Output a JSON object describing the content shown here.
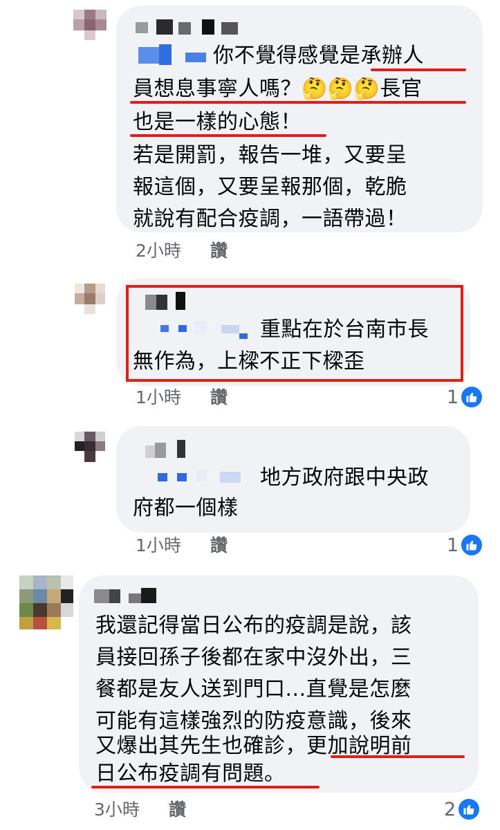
{
  "comments": [
    {
      "lines": [
        "你不覺得感覺是承辦人",
        "員想息事寧人嗎？🤔🤔🤔長官",
        "也是一樣的心態！",
        "若是開罰，報告一堆，又要呈",
        "報這個，又要呈報那個，乾脆",
        "就說有配合疫調，一語帶過！"
      ],
      "time": "2小時",
      "like_label": "讚",
      "reaction_count": ""
    },
    {
      "lines": [
        "重點在於台南市長",
        "無作為，上樑不正下樑歪"
      ],
      "time": "1小時",
      "like_label": "讚",
      "reaction_count": "1"
    },
    {
      "lines": [
        "地方政府跟中央政",
        "府都一個樣"
      ],
      "time": "1小時",
      "like_label": "讚",
      "reaction_count": "1"
    },
    {
      "lines": [
        "我還記得當日公布的疫調是說，該",
        "員接回孫子後都在家中沒外出，三",
        "餐都是友人送到門口...直覺是怎麼",
        "可能有這樣強烈的防疫意識，後來",
        "又爆出其先生也確診，更加說明前",
        "日公布疫調有問題。"
      ],
      "time": "3小時",
      "like_label": "讚",
      "reaction_count": "2"
    }
  ],
  "colors": {
    "bubble": "#f0f2f5",
    "meta_text": "#65676b",
    "like_blue": "#1877f2",
    "highlight_red": "#e02018"
  },
  "icons": {
    "reaction": "thumbs-up-icon"
  }
}
